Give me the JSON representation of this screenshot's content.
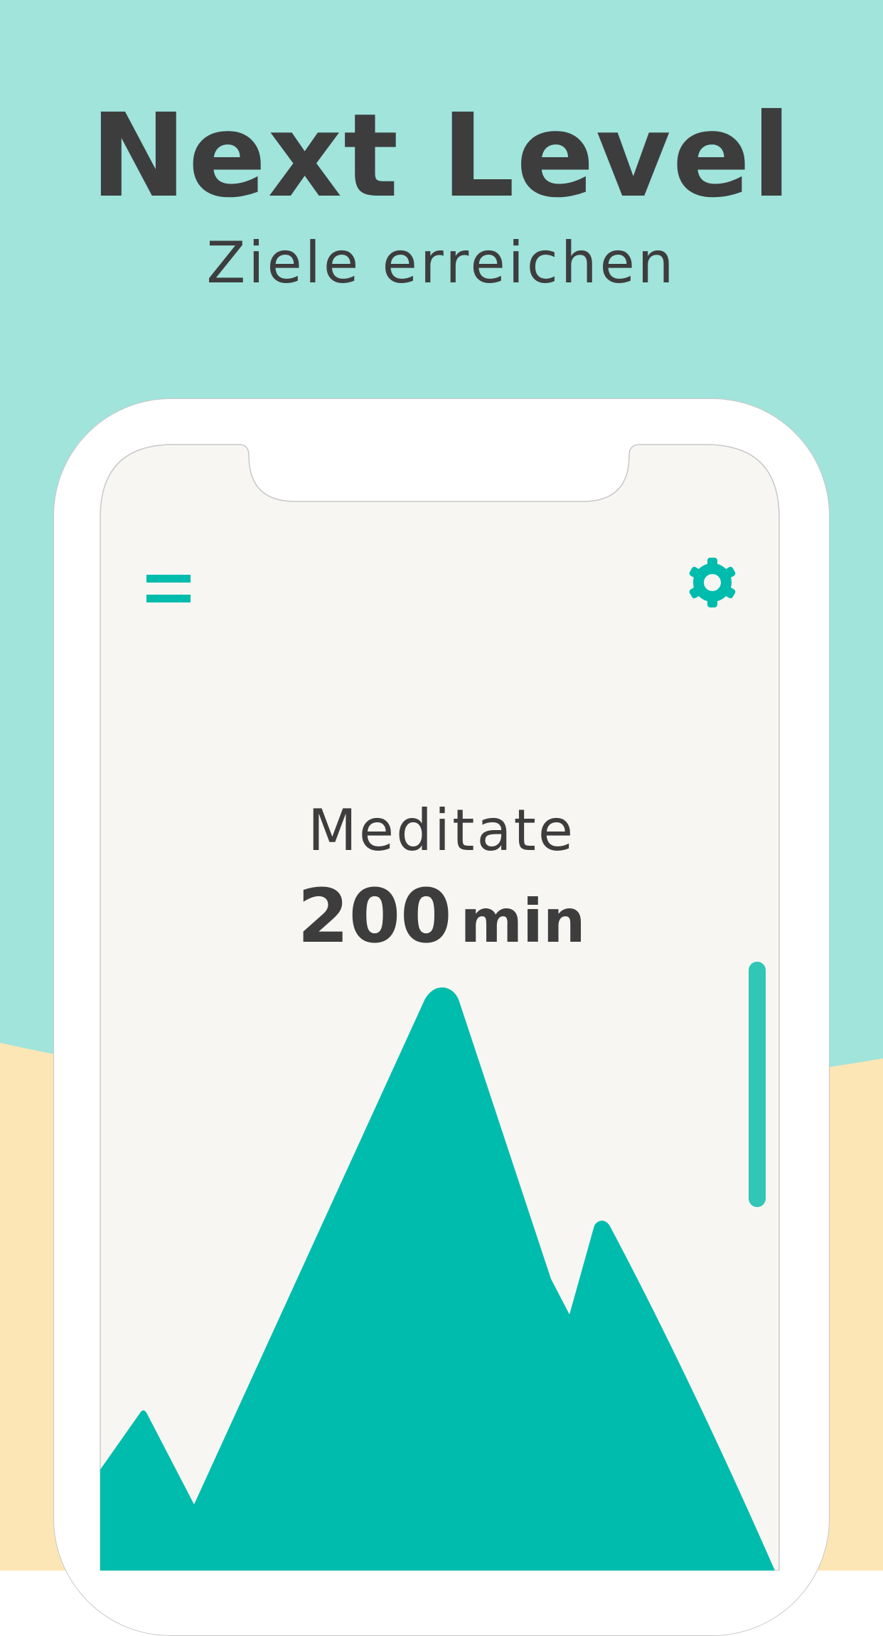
{
  "header": {
    "title": "Next Level",
    "subtitle": "Ziele erreichen"
  },
  "app": {
    "menu_icon": "hamburger-menu-icon",
    "settings_icon": "gear-icon",
    "activity": "Meditate",
    "goal_value": "200",
    "goal_unit": "min"
  },
  "colors": {
    "background_top": "#a0e4dc",
    "background_bottom": "#fde6b5",
    "accent": "#00bcac",
    "screen": "#f7f6f3",
    "text": "#3d3d3d"
  }
}
